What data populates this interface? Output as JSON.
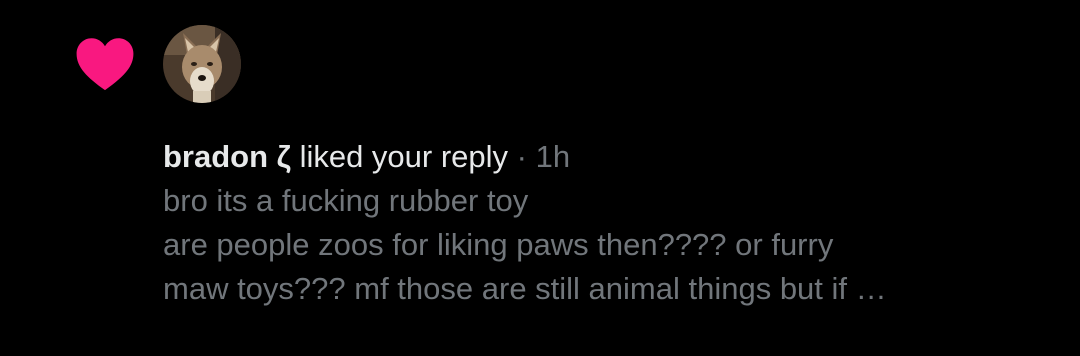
{
  "notification": {
    "type": "like",
    "icon": "heart-icon",
    "icon_color": "#f91880",
    "avatar": "coyote-avatar",
    "user_name": "bradon ζ",
    "action_text": "liked your reply",
    "separator": "·",
    "timestamp": "1h",
    "reply_lines": [
      "bro its a fucking rubber toy",
      "are people zoos for liking paws then???? or furry",
      "maw toys??? mf those are still animal things but if …"
    ]
  },
  "colors": {
    "background": "#000000",
    "primary_text": "#e7e9ea",
    "secondary_text": "#71767b"
  }
}
